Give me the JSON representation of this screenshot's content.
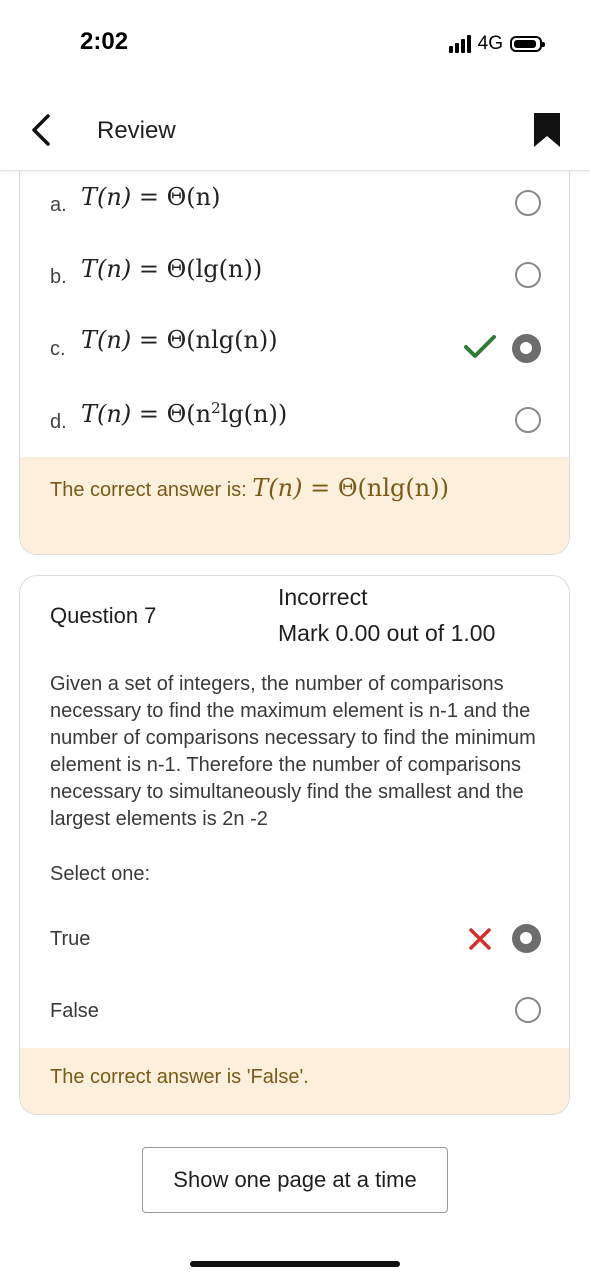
{
  "status_bar": {
    "time": "2:02",
    "network": "4G"
  },
  "header": {
    "title": "Review",
    "back_icon": "chevron-left-icon",
    "bookmark_icon": "bookmark-icon"
  },
  "question6": {
    "options": [
      {
        "letter": "a.",
        "lhs": "T(n)",
        "eq": " = ",
        "rhs": "Θ(n)",
        "selected": false,
        "mark": ""
      },
      {
        "letter": "b.",
        "lhs": "T(n)",
        "eq": " = ",
        "rhs": "Θ(lg(n))",
        "selected": false,
        "mark": ""
      },
      {
        "letter": "c.",
        "lhs": "T(n)",
        "eq": " = ",
        "rhs": "Θ(nlg(n))",
        "selected": true,
        "mark": "correct"
      },
      {
        "letter": "d.",
        "lhs": "T(n)",
        "eq": " = ",
        "rhs_pre": "Θ(n",
        "rhs_sup": "2",
        "rhs_post": "lg(n))",
        "selected": false,
        "mark": ""
      }
    ],
    "feedback_prefix": "The correct answer is: ",
    "feedback_lhs": "T(n)",
    "feedback_eq": " = ",
    "feedback_rhs": "Θ(nlg(n))"
  },
  "question7": {
    "label": "Question 7",
    "status": "Incorrect",
    "mark": "Mark 0.00 out of 1.00",
    "text": "Given a set of integers, the number of comparisons necessary to find the maximum element is n-1 and the number of comparisons necessary to find the minimum element is n-1. Therefore the number of comparisons necessary to simultaneously find the smallest and  the largest elements is 2n -2",
    "select_prompt": "Select one:",
    "options": [
      {
        "label": "True",
        "selected": true,
        "mark": "incorrect"
      },
      {
        "label": "False",
        "selected": false,
        "mark": ""
      }
    ],
    "feedback": "The correct answer is 'False'."
  },
  "footer": {
    "show_one_page_label": "Show one page at a time"
  },
  "colors": {
    "feedback_bg": "#fcefdc",
    "feedback_text": "#7a5a16",
    "correct": "#2e7d32",
    "incorrect": "#d32f2f",
    "radio_selected": "#6d6d6d"
  }
}
